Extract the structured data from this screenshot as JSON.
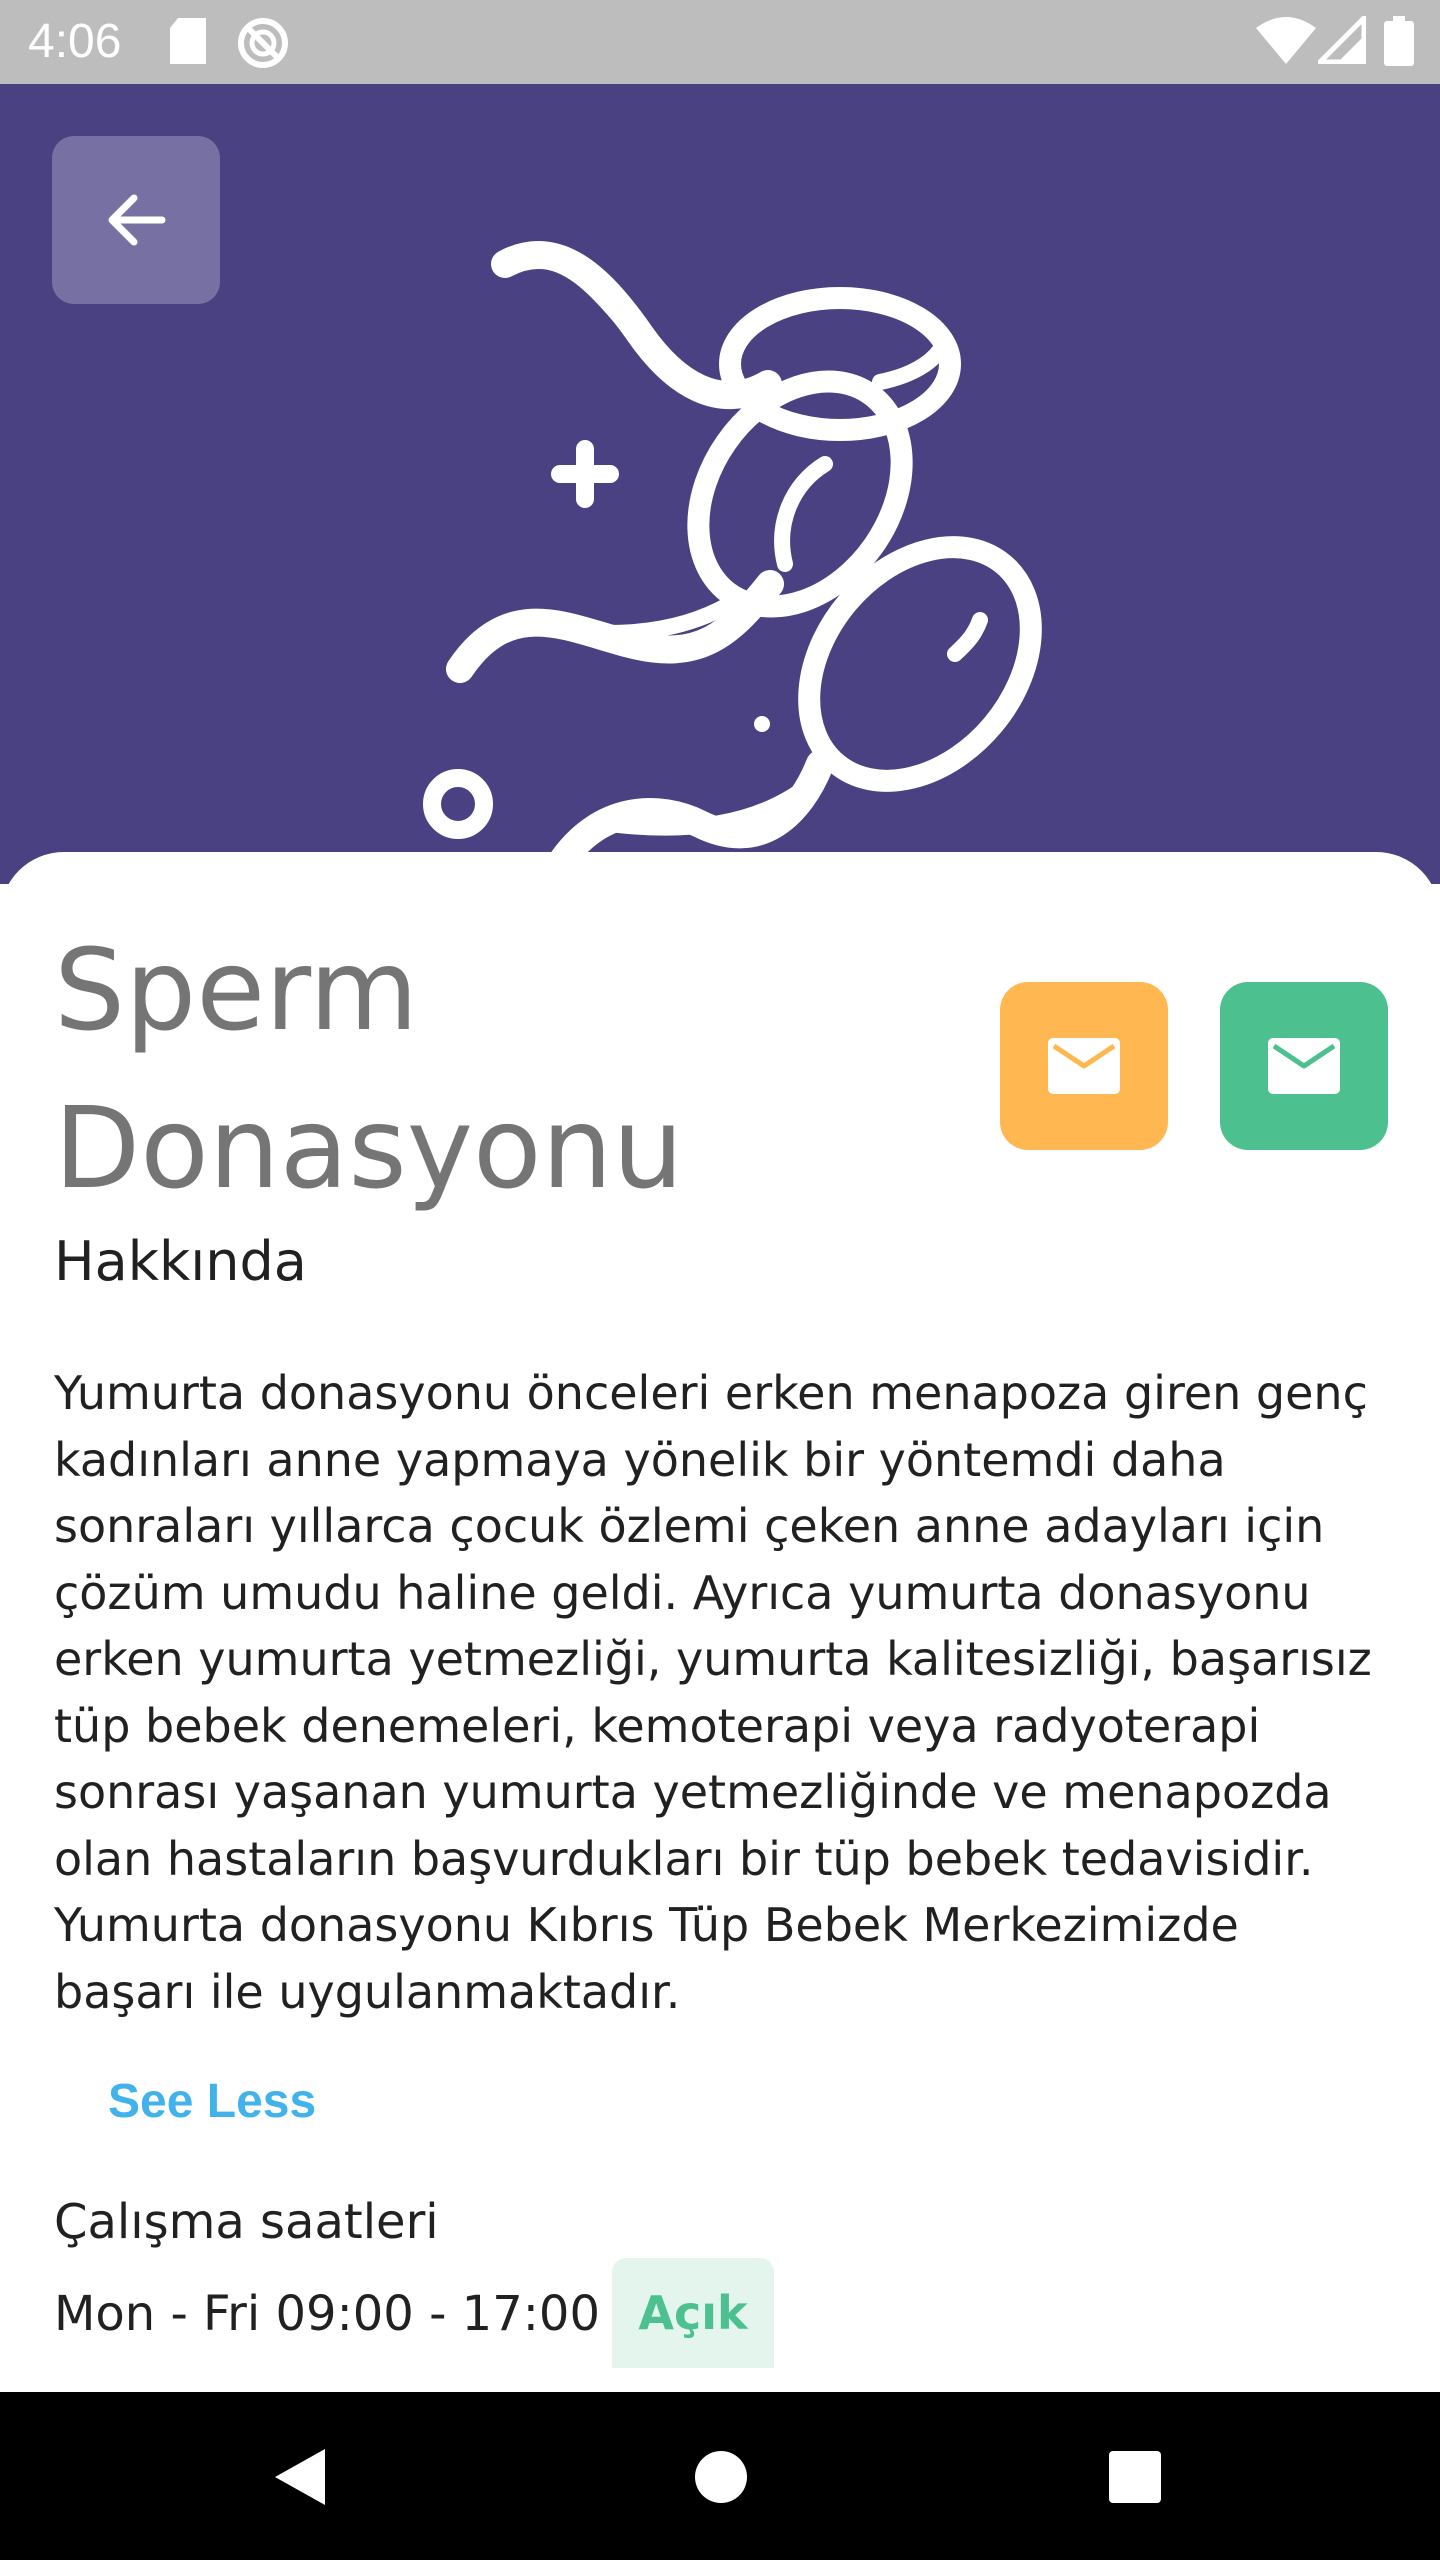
{
  "status_bar": {
    "time": "4:06",
    "icons": [
      "sd-card-icon",
      "do-not-disturb-icon",
      "wifi-icon",
      "signal-icon",
      "battery-icon"
    ]
  },
  "header": {
    "background_color": "#4a4183",
    "back_icon": "arrow-left-icon",
    "illustration": "sperm-cells-illustration"
  },
  "detail": {
    "title": "Sperm Donasyonu",
    "actions": [
      {
        "icon": "mail-icon",
        "color": "#ffb851"
      },
      {
        "icon": "mail-icon",
        "color": "#4cc08e"
      }
    ],
    "about_heading": "Hakkında",
    "about_text": "Yumurta donasyonu önceleri erken menapoza giren genç kadınları anne yapmaya yönelik bir yöntemdi daha sonraları yıllarca çocuk özlemi çeken anne adayları için çözüm umudu haline geldi. Ayrıca yumurta donasyonu erken yumurta yetmezliği, yumurta kalitesizliği, başarısız tüp bebek denemeleri, kemoterapi veya radyoterapi sonrası yaşanan yumurta yetmezliğinde ve menapozda olan hastaların başvurdukları bir tüp bebek tedavisidir. Yumurta donasyonu Kıbrıs Tüp Bebek Merkezimizde başarı ile uygulanmaktadır.",
    "see_less_label": "See Less",
    "hours_heading": "Çalışma saatleri",
    "hours_value": "Mon - Fri 09:00 - 17:00",
    "open_status": "Açık"
  },
  "nav_bar": {
    "buttons": [
      "back-triangle-icon",
      "home-circle-icon",
      "recents-square-icon"
    ]
  }
}
